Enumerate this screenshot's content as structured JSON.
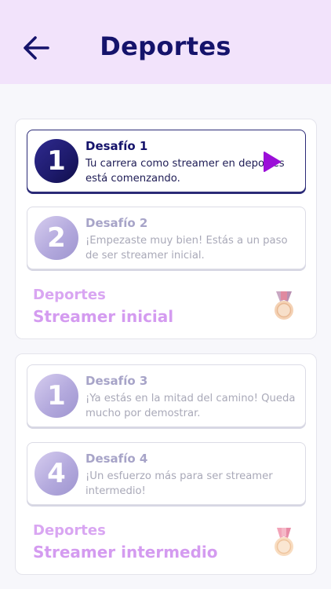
{
  "header": {
    "title": "Deportes",
    "back_icon": "arrow-left-icon"
  },
  "colors": {
    "header_bg": "#f2e3fb",
    "title": "#15136b",
    "accent_play": "#9b0fd8",
    "level_text": "#d49bf0"
  },
  "levels": [
    {
      "category": "Deportes",
      "name": "Streamer inicial",
      "medal_icon": "bronze-medal-icon",
      "challenges": [
        {
          "number": "1",
          "title": "Desafío 1",
          "description": "Tu carrera como streamer en deportes está comenzando.",
          "state": "active",
          "action_icon": "play-icon"
        },
        {
          "number": "2",
          "title": "Desafío 2",
          "description": "¡Empezaste muy bien! Estás a un paso de ser streamer inicial.",
          "state": "locked"
        }
      ]
    },
    {
      "category": "Deportes",
      "name": "Streamer intermedio",
      "medal_icon": "medal-icon",
      "challenges": [
        {
          "number": "1",
          "title": "Desafío 3",
          "description": "¡Ya estás en la mitad del camino! Queda mucho por demostrar.",
          "state": "locked"
        },
        {
          "number": "4",
          "title": "Desafío 4",
          "description": "¡Un esfuerzo más para ser streamer intermedio!",
          "state": "locked"
        }
      ]
    }
  ]
}
